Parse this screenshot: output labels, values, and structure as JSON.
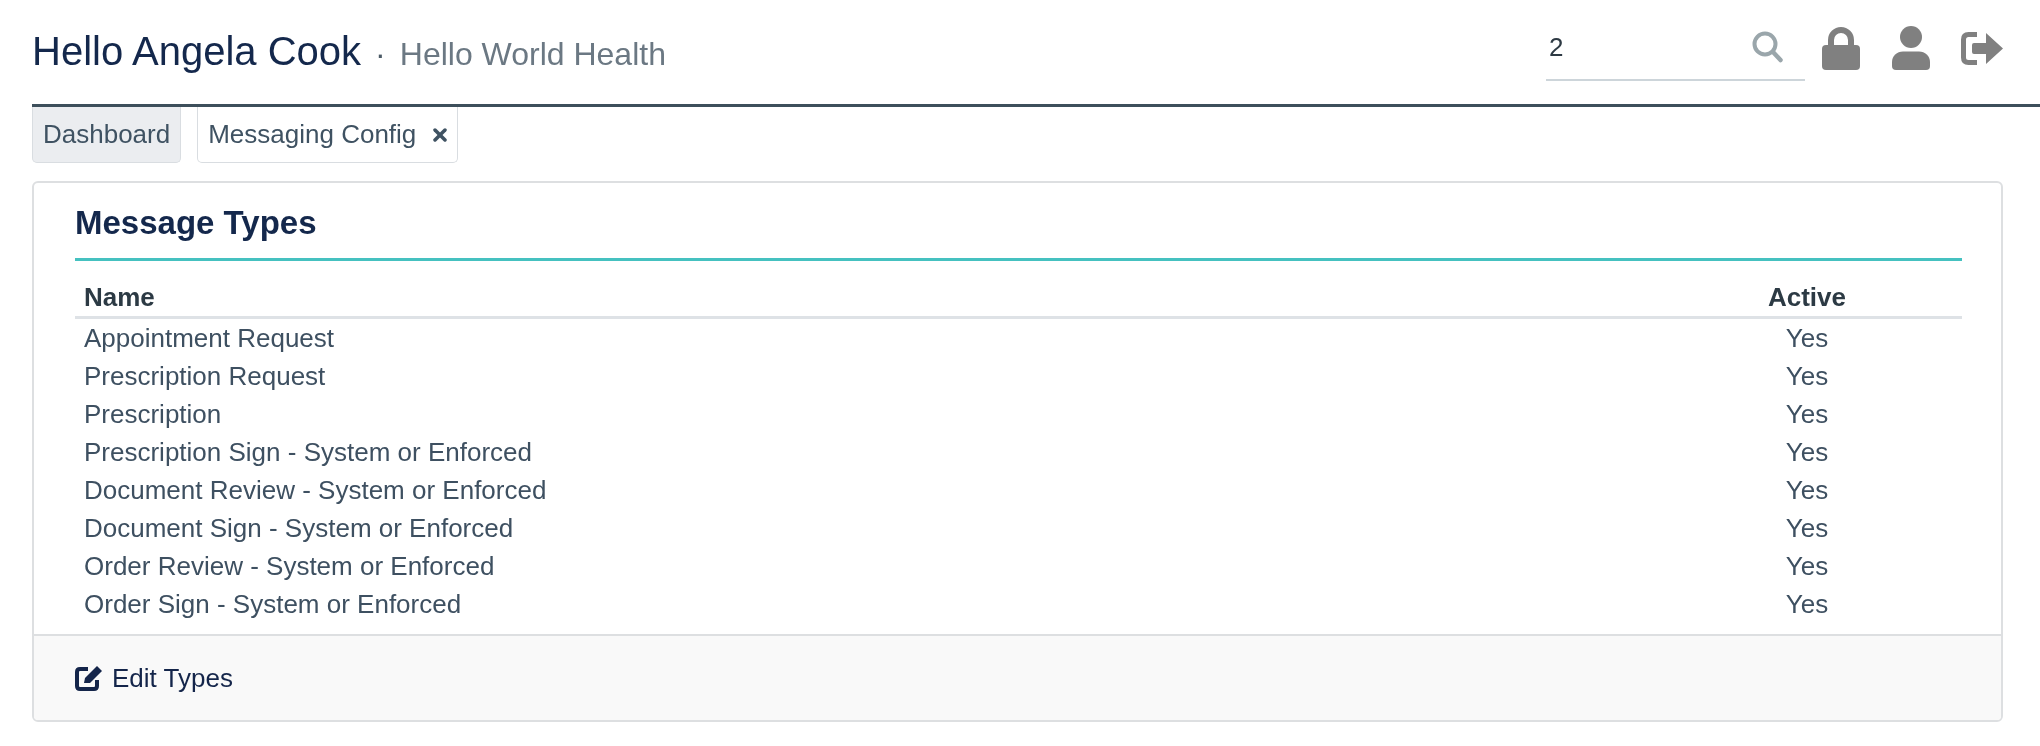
{
  "header": {
    "greeting": "Hello Angela Cook",
    "separator": "·",
    "organization": "Hello World Health",
    "search": {
      "value": "2"
    }
  },
  "tabs": [
    {
      "label": "Dashboard",
      "selected": false,
      "closable": false
    },
    {
      "label": "Messaging Config",
      "selected": true,
      "closable": true
    }
  ],
  "panel": {
    "title": "Message Types",
    "table": {
      "columns": [
        "Name",
        "Active"
      ],
      "rows": [
        [
          "Appointment Request",
          "Yes"
        ],
        [
          "Prescription Request",
          "Yes"
        ],
        [
          "Prescription",
          "Yes"
        ],
        [
          "Prescription Sign - System or Enforced",
          "Yes"
        ],
        [
          "Document Review - System or Enforced",
          "Yes"
        ],
        [
          "Document Sign - System or Enforced",
          "Yes"
        ],
        [
          "Order Review - System or Enforced",
          "Yes"
        ],
        [
          "Order Sign - System or Enforced",
          "Yes"
        ]
      ]
    },
    "footer": {
      "action": "Edit Types"
    }
  }
}
